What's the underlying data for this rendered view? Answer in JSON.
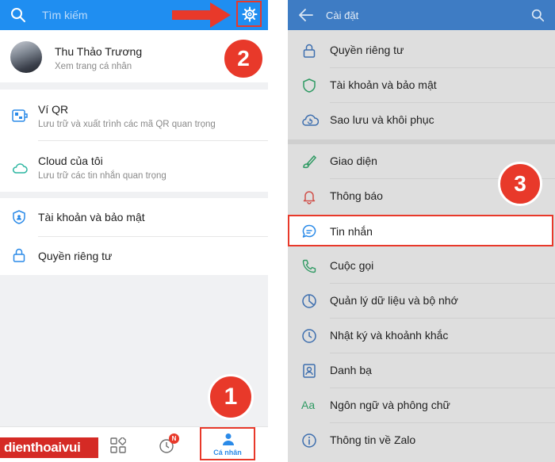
{
  "left": {
    "search_placeholder": "Tìm kiếm",
    "profile": {
      "name": "Thu Thảo Trương",
      "subtitle": "Xem trang cá nhân"
    },
    "items": [
      {
        "title": "Ví QR",
        "subtitle": "Lưu trữ và xuất trình các mã QR quan trọng"
      },
      {
        "title": "Cloud của tôi",
        "subtitle": "Lưu trữ các tin nhắn quan trọng"
      },
      {
        "title": "Tài khoản và bảo mật"
      },
      {
        "title": "Quyền riêng tư"
      }
    ],
    "bottom_nav": {
      "notification_badge": "N",
      "active_label": "Cá nhân"
    },
    "watermark": "dienthoaivui"
  },
  "right": {
    "title": "Cài đặt",
    "group1": [
      "Quyền riêng tư",
      "Tài khoản và bảo mật",
      "Sao lưu và khôi phục"
    ],
    "group2": [
      "Giao diện",
      "Thông báo",
      "Tin nhắn",
      "Cuộc gọi",
      "Quản lý dữ liệu và bộ nhớ",
      "Nhật ký và khoảnh khắc",
      "Danh bạ",
      "Ngôn ngữ và phông chữ",
      "Thông tin về Zalo"
    ],
    "lang_icon_text": "Aa"
  },
  "annotations": {
    "step1": "1",
    "step2": "2",
    "step3": "3"
  },
  "colors": {
    "zalo_blue": "#1f8ef1",
    "annotation_red": "#e8392a",
    "dim_overlay": "#dedede"
  }
}
